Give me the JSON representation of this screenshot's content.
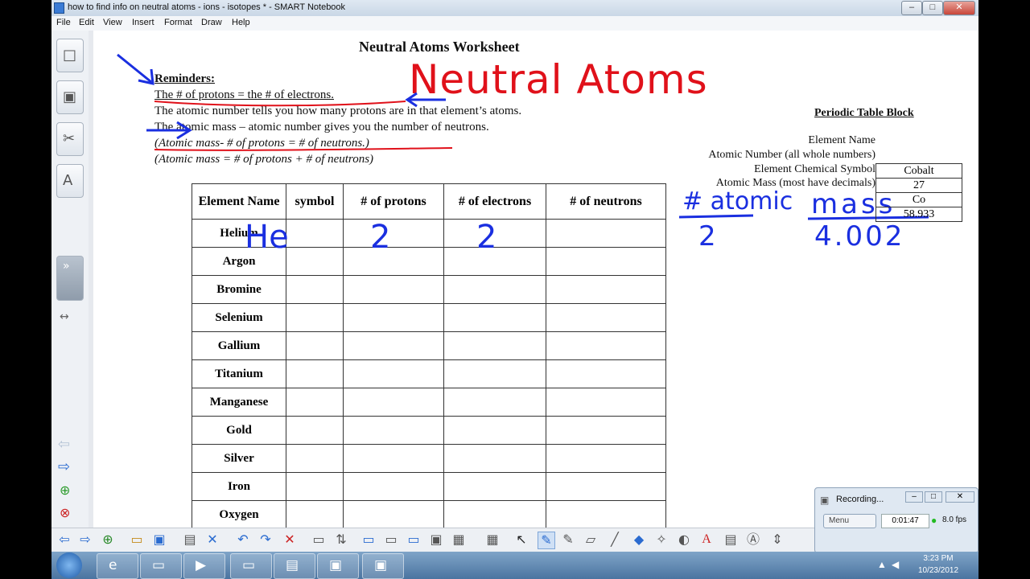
{
  "window": {
    "title": "how to find info on neutral atoms - ions - isotopes * - SMART Notebook",
    "controls": {
      "minimize": "–",
      "maximize": "□",
      "close": "✕"
    }
  },
  "menu": [
    "File",
    "Edit",
    "View",
    "Insert",
    "Format",
    "Draw",
    "Help"
  ],
  "side_tabs": [
    {
      "icon": "page-sorter-icon",
      "glyph": "□"
    },
    {
      "icon": "gallery-icon",
      "glyph": "▣"
    },
    {
      "icon": "attachments-icon",
      "glyph": "✂"
    },
    {
      "icon": "properties-icon",
      "glyph": "A"
    }
  ],
  "worksheet": {
    "title": "Neutral Atoms Worksheet",
    "reminders_heading": "Reminders:",
    "reminders": [
      "The # of protons = the # of electrons.",
      "The atomic number tells you how many protons are in that element’s atoms.",
      "The atomic mass – atomic number gives you the number of neutrons.",
      "(Atomic mass- # of protons = # of neutrons.)",
      "(Atomic mass = # of protons + # of neutrons)"
    ],
    "handwritten_title": "Neutral Atoms",
    "periodic_block": {
      "heading": "Periodic Table Block",
      "labels": [
        "Element Name",
        "Atomic Number (all whole numbers)",
        "Element Chemical Symbol",
        "Atomic Mass (most have decimals)"
      ],
      "values": [
        "Cobalt",
        "27",
        "Co",
        "58.933"
      ]
    },
    "table": {
      "headers": [
        "Element Name",
        "symbol",
        "# of protons",
        "# of electrons",
        "# of neutrons"
      ],
      "rows": [
        "Helium",
        "Argon",
        "Bromine",
        "Selenium",
        "Gallium",
        "Titanium",
        "Manganese",
        "Gold",
        "Silver",
        "Iron",
        "Oxygen"
      ],
      "helium_handwritten": {
        "symbol": "He",
        "protons": "2",
        "electrons": "2"
      }
    },
    "handwritten_notes": {
      "atomic_label": "# atomic",
      "atomic_value": "2",
      "mass_label": "mass",
      "mass_value": "4.002"
    }
  },
  "recording": {
    "title": "Recording...",
    "menu_label": "Menu",
    "time": "0:01:47",
    "fps": "8.0 fps"
  },
  "taskbar": {
    "time": "3:23 PM",
    "date": "10/23/2012"
  },
  "colors": {
    "ink_blue": "#1a2fe0",
    "ink_red": "#e0111a",
    "taskbar": "#5b84b0"
  }
}
